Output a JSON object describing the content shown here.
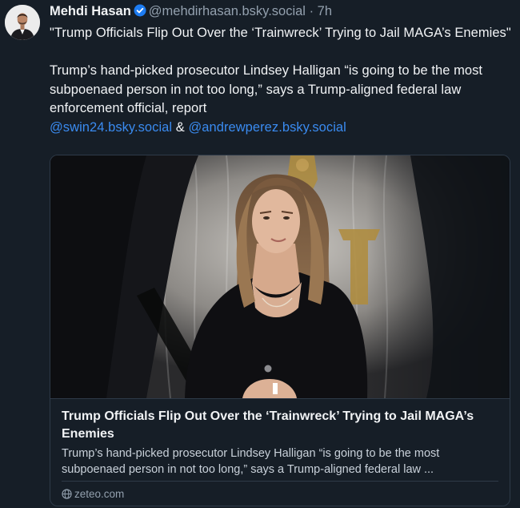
{
  "author": {
    "display_name": "Mehdi Hasan",
    "handle": "@mehdirhasan.bsky.social",
    "separator": "·",
    "time_ago": "7h"
  },
  "post": {
    "line1": "\"Trump Officials Flip Out Over the ‘Trainwreck’ Trying to Jail MAGA’s Enemies\"",
    "line2": "Trump’s hand-picked prosecutor Lindsey Halligan “is going to be the most subpoenaed person in not too long,” says a Trump-aligned federal law enforcement official, report",
    "mention1": "@swin24.bsky.social",
    "conjunction": "&",
    "mention2": "@andrewperez.bsky.social"
  },
  "link_card": {
    "title": "Trump Officials Flip Out Over the ‘Trainwreck’ Trying to Jail MAGA’s Enemies",
    "description": "Trump’s hand-picked prosecutor Lindsey Halligan “is going to be the most subpoenaed person in not too long,” says a Trump-aligned federal law ...",
    "domain": "zeteo.com"
  },
  "colors": {
    "background": "#161e27",
    "text": "#f1f3f5",
    "muted": "#93a0ae",
    "link": "#3a8bf0",
    "verified": "#1d7cf2",
    "border": "#2e3a48"
  }
}
